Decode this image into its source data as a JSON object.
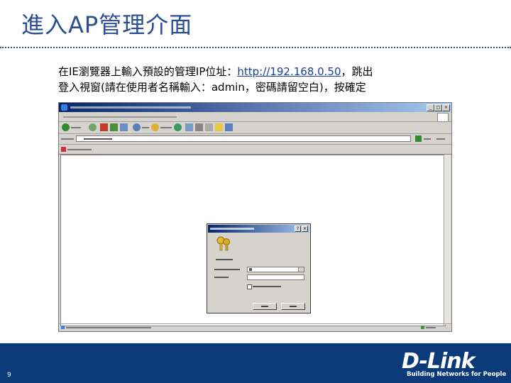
{
  "slide": {
    "title": "進入AP管理介面",
    "instruction_line1_pre": "在IE瀏覽器上輸入預設的管理IP位址：",
    "instruction_url": "http://192.168.0.50",
    "instruction_line1_post": "，跳出",
    "instruction_line2": "登入視窗(請在使用者名稱輸入：admin，密碼請留空白)，按確定",
    "page_number": "9"
  },
  "brand": {
    "logo": "D-Link",
    "tagline": "Building Networks for People"
  },
  "colors": {
    "title": "#2a4e8f",
    "footer_bg": "#0b3a7a",
    "titlebar": "#0a246a"
  }
}
